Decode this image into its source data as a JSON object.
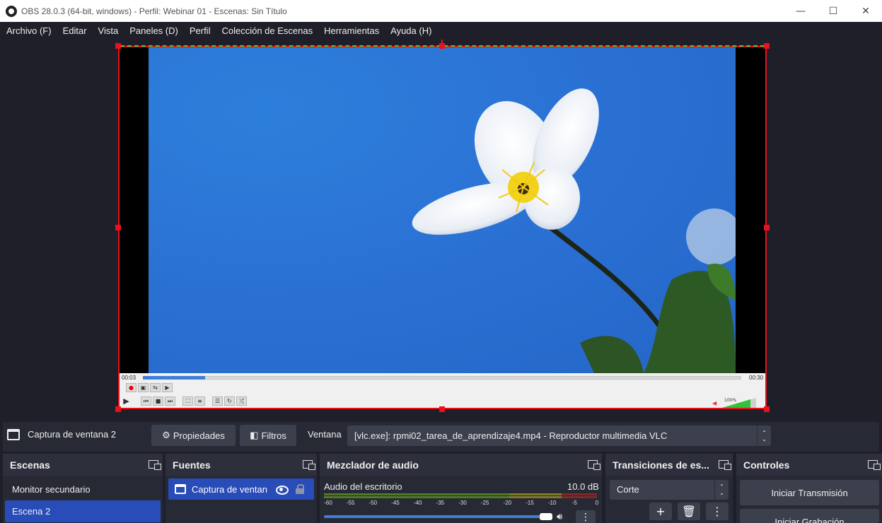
{
  "window": {
    "title": "OBS 28.0.3 (64-bit, windows) - Perfil: Webinar 01 - Escenas: Sin Título",
    "minimize": "—",
    "maximize": "☐",
    "close": "✕"
  },
  "menubar": {
    "items": [
      "Archivo (F)",
      "Editar",
      "Vista",
      "Paneles (D)",
      "Perfil",
      "Colección de Escenas",
      "Herramientas",
      "Ayuda (H)"
    ]
  },
  "preview": {
    "vlc_time_elapsed": "00:03",
    "vlc_time_total": "00:30",
    "vlc_volume_percent": "100%",
    "vlc_progress_fraction": 0.1
  },
  "context": {
    "source_name": "Captura de ventana 2",
    "properties_label": "Propiedades",
    "filters_label": "Filtros",
    "window_label": "Ventana",
    "window_value": "[vlc.exe]: rpmi02_tarea_de_aprendizaje4.mp4 - Reproductor multimedia VLC"
  },
  "docks": {
    "scenes": {
      "title": "Escenas",
      "items": [
        "Monitor secundario",
        "Escena 2"
      ],
      "active_index": 1
    },
    "sources": {
      "title": "Fuentes",
      "items": [
        {
          "name": "Captura de ventan",
          "visible": true,
          "locked": true
        }
      ]
    },
    "mixer": {
      "title": "Mezclador de audio",
      "channel_name": "Audio del escritorio",
      "channel_db": "10.0 dB",
      "ticks": [
        "-60",
        "-55",
        "-50",
        "-45",
        "-40",
        "-35",
        "-30",
        "-25",
        "-20",
        "-15",
        "-10",
        "-5",
        "0"
      ],
      "volume_fraction": 0.95
    },
    "transitions": {
      "title": "Transiciones de es...",
      "selected": "Corte"
    },
    "controls": {
      "title": "Controles",
      "start_stream": "Iniciar Transmisión",
      "start_recording": "Iniciar Grabación"
    }
  },
  "colors": {
    "accent": "#284cb8",
    "selection_border": "#e8111d",
    "safe_area": "#35d42c",
    "background": "#1e1f29",
    "panel": "#272a35",
    "button": "#3c404d"
  }
}
